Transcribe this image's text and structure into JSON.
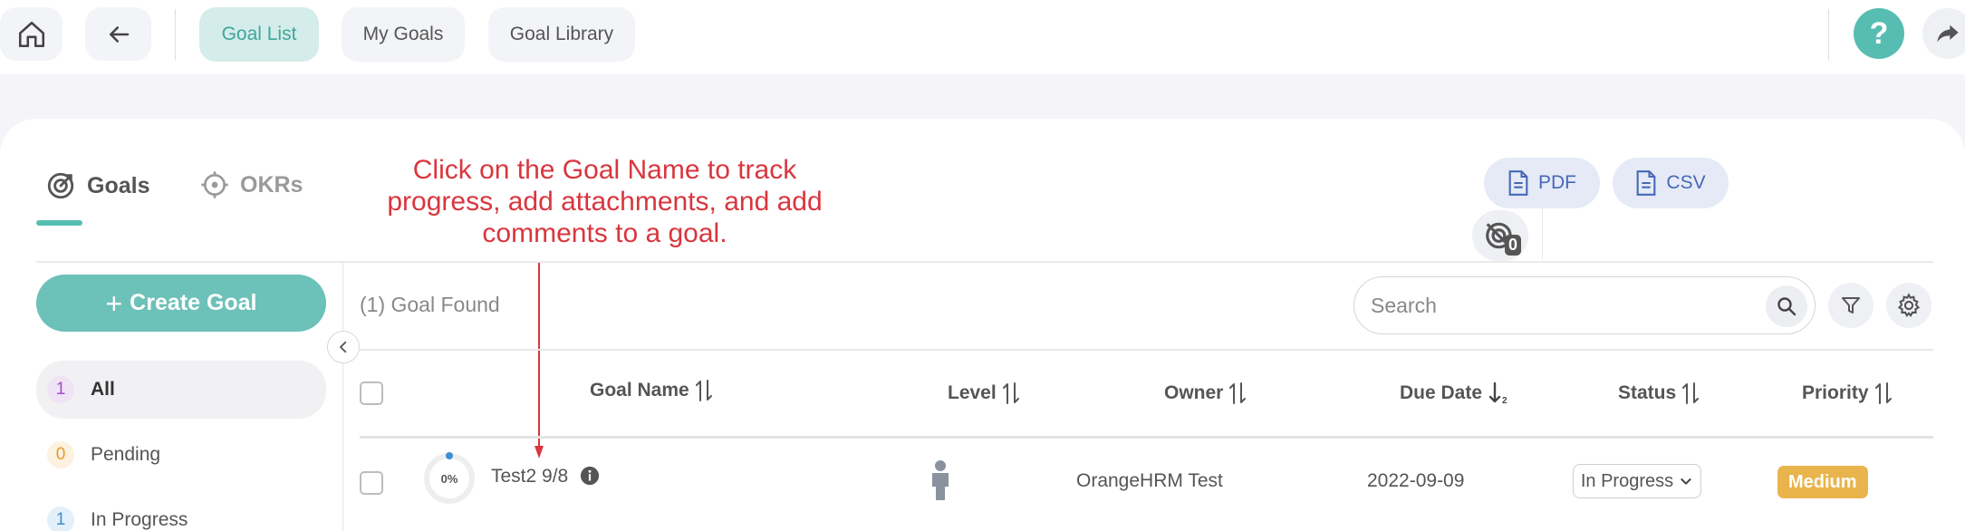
{
  "nav": {
    "tabs": [
      {
        "label": "Goal List",
        "active": true
      },
      {
        "label": "My Goals",
        "active": false
      },
      {
        "label": "Goal Library",
        "active": false
      }
    ],
    "help_label": "?"
  },
  "goal_tabs": [
    {
      "label": "Goals",
      "active": true,
      "icon": "goal-target-icon"
    },
    {
      "label": "OKRs",
      "active": false,
      "icon": "crosshair-icon"
    }
  ],
  "annotation": "Click on the Goal Name to track progress, add attachments, and add comments to a goal.",
  "export": {
    "pdf_label": "PDF",
    "csv_label": "CSV",
    "archived_count": "0"
  },
  "sidebar": {
    "create_label": "Create Goal",
    "filters": [
      {
        "count": "1",
        "label": "All",
        "active": true,
        "color": "#a14fc9",
        "bg": "#efe3f6"
      },
      {
        "count": "0",
        "label": "Pending",
        "active": false,
        "color": "#e39b2d",
        "bg": "#fdf1e0"
      },
      {
        "count": "1",
        "label": "In Progress",
        "active": false,
        "color": "#3d8ed6",
        "bg": "#e3eff9"
      }
    ]
  },
  "results": {
    "found_text": "(1) Goal Found"
  },
  "search": {
    "placeholder": "Search"
  },
  "table": {
    "headers": {
      "goal_name": "Goal Name",
      "level": "Level",
      "owner": "Owner",
      "due_date": "Due Date",
      "status": "Status",
      "priority": "Priority"
    },
    "rows": [
      {
        "progress": "0%",
        "progress_value": 0,
        "goal_name": "Test2 9/8",
        "owner": "OrangeHRM Test",
        "due_date": "2022-09-09",
        "status": "In Progress",
        "priority": "Medium"
      }
    ]
  },
  "colors": {
    "accent": "#57bdb2",
    "annotation": "#d9363e",
    "priority_medium": "#e9b44c"
  }
}
